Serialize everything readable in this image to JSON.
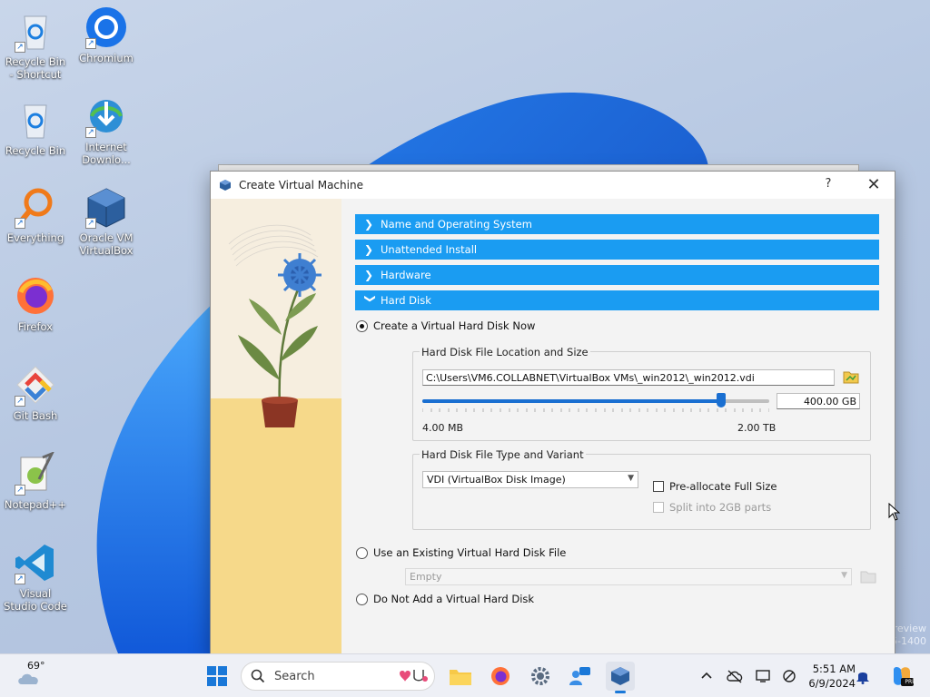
{
  "desktop": {
    "icons": [
      {
        "label": "Recycle Bin - Shortcut",
        "icon": "recycle-bin-icon"
      },
      {
        "label": "Chromium",
        "icon": "chromium-icon"
      },
      {
        "label": "Recycle Bin",
        "icon": "recycle-bin-icon"
      },
      {
        "label": "Internet Downlo...",
        "icon": "internet-download-manager-icon"
      },
      {
        "label": "Everything",
        "icon": "everything-search-icon"
      },
      {
        "label": "Oracle VM VirtualBox",
        "icon": "virtualbox-icon"
      },
      {
        "label": "Firefox",
        "icon": "firefox-icon"
      },
      {
        "label": "Git Bash",
        "icon": "git-bash-icon"
      },
      {
        "label": "Notepad++",
        "icon": "notepad-plus-plus-icon"
      },
      {
        "label": "Visual Studio Code",
        "icon": "vscode-icon"
      }
    ],
    "watermark": {
      "line1": "review",
      "line2": "5-1400"
    }
  },
  "dialog": {
    "title": "Create Virtual Machine",
    "help": "?",
    "close": "✕",
    "sections": [
      {
        "label": "Name and Operating System",
        "expanded": false
      },
      {
        "label": "Unattended Install",
        "expanded": false
      },
      {
        "label": "Hardware",
        "expanded": false
      },
      {
        "label": "Hard Disk",
        "expanded": true
      }
    ],
    "options": {
      "create_new": "Create a Virtual Hard Disk Now",
      "use_existing": "Use an Existing Virtual Hard Disk File",
      "no_disk": "Do Not Add a Virtual Hard Disk",
      "selected": "create_new"
    },
    "location_group": {
      "legend": "Hard Disk File Location and Size",
      "path": "C:\\Users\\VM6.COLLABNET\\VirtualBox VMs\\_win2012\\_win2012.vdi",
      "size_value": "400.00 GB",
      "min_label": "4.00 MB",
      "max_label": "2.00 TB",
      "slider_fraction": 0.86
    },
    "type_group": {
      "legend": "Hard Disk File Type and Variant",
      "type_value": "VDI (VirtualBox Disk Image)",
      "preallocate": "Pre-allocate Full Size",
      "split": "Split into 2GB parts"
    },
    "existing_file": {
      "value": "Empty"
    }
  },
  "taskbar": {
    "weather": "69°",
    "search_placeholder": "Search",
    "time": "5:51 AM",
    "date": "6/9/2024"
  },
  "colors": {
    "accent": "#1a9cf2",
    "slider": "#1a6fd1"
  }
}
